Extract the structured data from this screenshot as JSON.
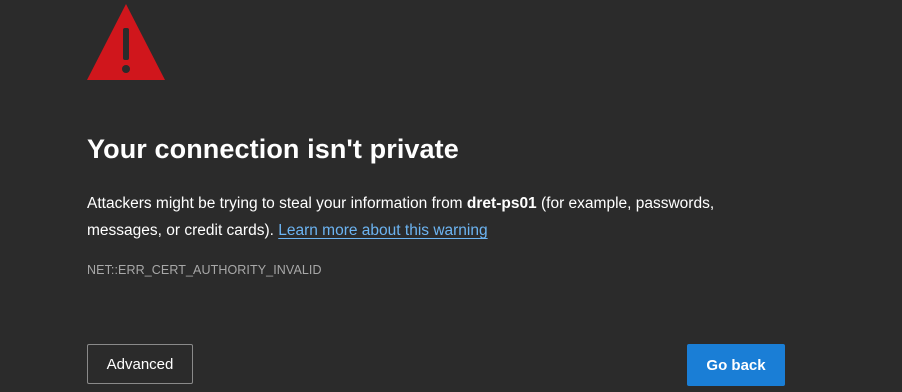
{
  "icon": "warning-triangle-icon",
  "colors": {
    "background": "#2b2b2b",
    "warning_red": "#d0161c",
    "link": "#6cb4f2",
    "primary_button": "#1a7ed6",
    "error_code_text": "#a8a8a8"
  },
  "title": "Your connection isn't private",
  "message": {
    "prefix": "Attackers might be trying to steal your information from ",
    "host": "dret-ps01",
    "suffix": " (for example, passwords, messages, or credit cards). ",
    "link_text": "Learn more about this warning"
  },
  "error_code": "NET::ERR_CERT_AUTHORITY_INVALID",
  "buttons": {
    "advanced": "Advanced",
    "go_back": "Go back"
  }
}
